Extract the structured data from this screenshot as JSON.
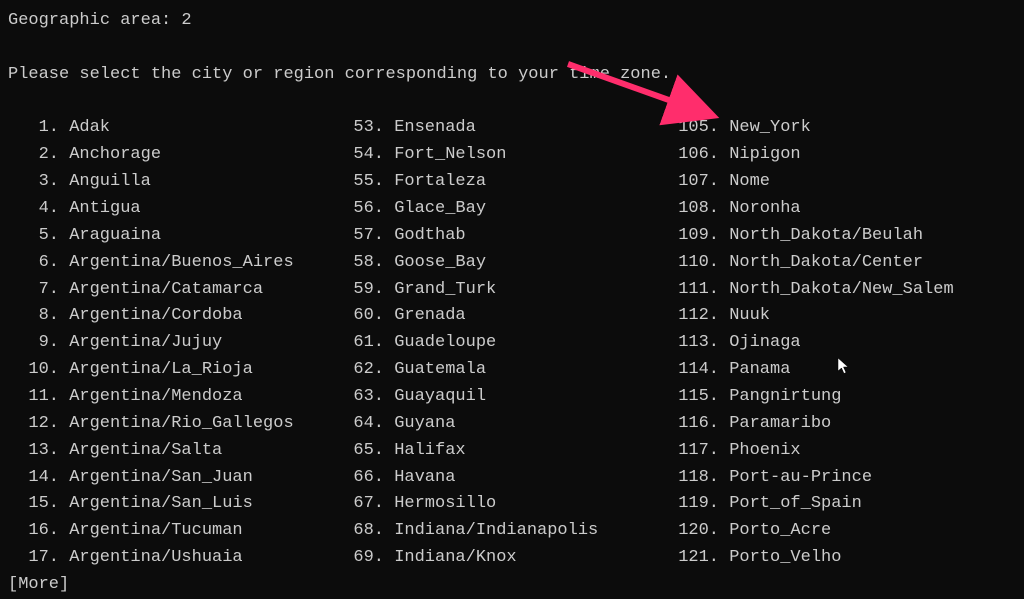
{
  "header": "Geographic area: 2",
  "prompt": "Please select the city or region corresponding to your time zone.",
  "more": "[More]",
  "columns": [
    [
      {
        "num": "1",
        "name": "Adak"
      },
      {
        "num": "2",
        "name": "Anchorage"
      },
      {
        "num": "3",
        "name": "Anguilla"
      },
      {
        "num": "4",
        "name": "Antigua"
      },
      {
        "num": "5",
        "name": "Araguaina"
      },
      {
        "num": "6",
        "name": "Argentina/Buenos_Aires"
      },
      {
        "num": "7",
        "name": "Argentina/Catamarca"
      },
      {
        "num": "8",
        "name": "Argentina/Cordoba"
      },
      {
        "num": "9",
        "name": "Argentina/Jujuy"
      },
      {
        "num": "10",
        "name": "Argentina/La_Rioja"
      },
      {
        "num": "11",
        "name": "Argentina/Mendoza"
      },
      {
        "num": "12",
        "name": "Argentina/Rio_Gallegos"
      },
      {
        "num": "13",
        "name": "Argentina/Salta"
      },
      {
        "num": "14",
        "name": "Argentina/San_Juan"
      },
      {
        "num": "15",
        "name": "Argentina/San_Luis"
      },
      {
        "num": "16",
        "name": "Argentina/Tucuman"
      },
      {
        "num": "17",
        "name": "Argentina/Ushuaia"
      }
    ],
    [
      {
        "num": "53",
        "name": "Ensenada"
      },
      {
        "num": "54",
        "name": "Fort_Nelson"
      },
      {
        "num": "55",
        "name": "Fortaleza"
      },
      {
        "num": "56",
        "name": "Glace_Bay"
      },
      {
        "num": "57",
        "name": "Godthab"
      },
      {
        "num": "58",
        "name": "Goose_Bay"
      },
      {
        "num": "59",
        "name": "Grand_Turk"
      },
      {
        "num": "60",
        "name": "Grenada"
      },
      {
        "num": "61",
        "name": "Guadeloupe"
      },
      {
        "num": "62",
        "name": "Guatemala"
      },
      {
        "num": "63",
        "name": "Guayaquil"
      },
      {
        "num": "64",
        "name": "Guyana"
      },
      {
        "num": "65",
        "name": "Halifax"
      },
      {
        "num": "66",
        "name": "Havana"
      },
      {
        "num": "67",
        "name": "Hermosillo"
      },
      {
        "num": "68",
        "name": "Indiana/Indianapolis"
      },
      {
        "num": "69",
        "name": "Indiana/Knox"
      }
    ],
    [
      {
        "num": "105",
        "name": "New_York"
      },
      {
        "num": "106",
        "name": "Nipigon"
      },
      {
        "num": "107",
        "name": "Nome"
      },
      {
        "num": "108",
        "name": "Noronha"
      },
      {
        "num": "109",
        "name": "North_Dakota/Beulah"
      },
      {
        "num": "110",
        "name": "North_Dakota/Center"
      },
      {
        "num": "111",
        "name": "North_Dakota/New_Salem"
      },
      {
        "num": "112",
        "name": "Nuuk"
      },
      {
        "num": "113",
        "name": "Ojinaga"
      },
      {
        "num": "114",
        "name": "Panama"
      },
      {
        "num": "115",
        "name": "Pangnirtung"
      },
      {
        "num": "116",
        "name": "Paramaribo"
      },
      {
        "num": "117",
        "name": "Phoenix"
      },
      {
        "num": "118",
        "name": "Port-au-Prince"
      },
      {
        "num": "119",
        "name": "Port_of_Spain"
      },
      {
        "num": "120",
        "name": "Porto_Acre"
      },
      {
        "num": "121",
        "name": "Porto_Velho"
      }
    ]
  ],
  "annotation": {
    "arrow_color": "#ff2d6c"
  }
}
